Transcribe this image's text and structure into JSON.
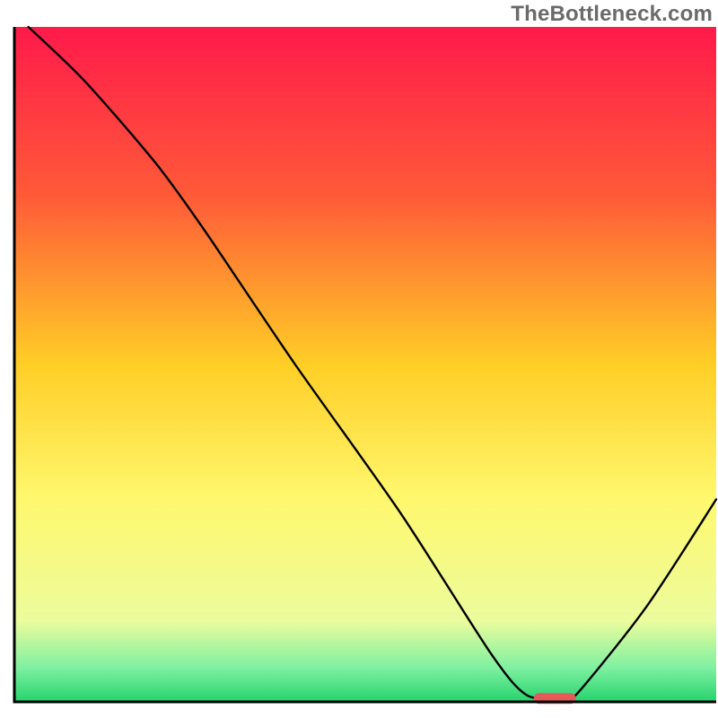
{
  "watermark": "TheBottleneck.com",
  "chart_data": {
    "type": "line",
    "title": "",
    "xlabel": "",
    "ylabel": "",
    "xrange": [
      0,
      100
    ],
    "yrange": [
      0,
      100
    ],
    "grid": false,
    "background_gradient": {
      "stops": [
        {
          "offset": 0,
          "color": "#ff1a4b"
        },
        {
          "offset": 25,
          "color": "#ff5a38"
        },
        {
          "offset": 50,
          "color": "#ffce26"
        },
        {
          "offset": 70,
          "color": "#fff86e"
        },
        {
          "offset": 88,
          "color": "#ecfc9d"
        },
        {
          "offset": 95,
          "color": "#7ef0a1"
        },
        {
          "offset": 100,
          "color": "#25d36d"
        }
      ]
    },
    "series": [
      {
        "name": "bottleneck-curve",
        "color": "#000000",
        "x": [
          2,
          10,
          20,
          27,
          40,
          55,
          68,
          73,
          78,
          80,
          90,
          100
        ],
        "y": [
          100,
          92,
          80,
          70,
          50,
          28,
          7,
          1,
          0.5,
          1,
          14,
          30
        ]
      }
    ],
    "marker": {
      "name": "optimal-point",
      "x": 77,
      "y": 0.5,
      "color": "#e45a5a",
      "width": 6,
      "height": 1.6
    }
  }
}
